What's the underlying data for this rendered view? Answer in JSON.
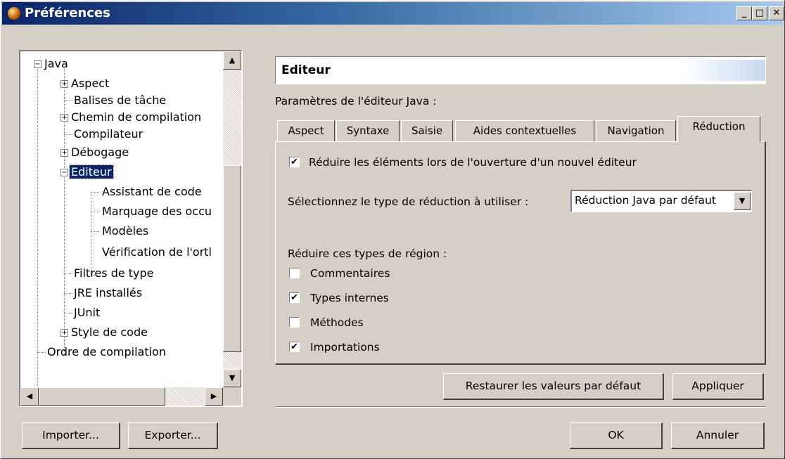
{
  "window": {
    "title": "Préférences"
  },
  "tree": {
    "items": [
      {
        "label": "Java",
        "expander": "minus"
      },
      {
        "label": "Aspect",
        "expander": "plus"
      },
      {
        "label": "Balises de tâche",
        "expander": ""
      },
      {
        "label": "Chemin de compilation",
        "expander": "plus"
      },
      {
        "label": "Compilateur",
        "expander": ""
      },
      {
        "label": "Débogage",
        "expander": "plus"
      },
      {
        "label": "Editeur",
        "expander": "minus",
        "selected": true
      },
      {
        "label": "Assistant de code",
        "expander": ""
      },
      {
        "label": "Marquage des occu",
        "expander": ""
      },
      {
        "label": "Modèles",
        "expander": ""
      },
      {
        "label": "Vérification de l'ortl",
        "expander": ""
      },
      {
        "label": "Filtres de type",
        "expander": ""
      },
      {
        "label": "JRE installés",
        "expander": ""
      },
      {
        "label": "JUnit",
        "expander": ""
      },
      {
        "label": "Style de code",
        "expander": "plus"
      },
      {
        "label": "Ordre de compilation",
        "expander": ""
      }
    ],
    "scroll_icons": {
      "up": "▲",
      "down": "▼",
      "left": "◀",
      "right": "▶"
    }
  },
  "page": {
    "header": "Editeur",
    "description": "Paramètres de l'éditeur Java :",
    "tabs": [
      {
        "label": "Aspect"
      },
      {
        "label": "Syntaxe"
      },
      {
        "label": "Saisie"
      },
      {
        "label": "Aides contextuelles"
      },
      {
        "label": "Navigation"
      },
      {
        "label": "Réduction",
        "active": true
      }
    ],
    "reduction": {
      "enable_label": "Réduire les éléments lors de l'ouverture d'un nouvel éditeur",
      "enable_checked": true,
      "type_label": "Sélectionnez le type de réduction à utiliser :",
      "type_value": "Réduction Java par défaut",
      "region_label": "Réduire ces types de région :",
      "regions": [
        {
          "label": "Commentaires",
          "checked": false
        },
        {
          "label": "Types internes",
          "checked": true
        },
        {
          "label": "Méthodes",
          "checked": false
        },
        {
          "label": "Importations",
          "checked": true
        }
      ]
    },
    "restore_button": "Restaurer les valeurs par défaut",
    "apply_button": "Appliquer"
  },
  "footer": {
    "import_button": "Importer...",
    "export_button": "Exporter...",
    "ok_button": "OK",
    "cancel_button": "Annuler"
  },
  "glyphs": {
    "check": "✔",
    "minus": "−",
    "plus": "+",
    "dropdown": "▼",
    "minimize": "_",
    "maximize": "□",
    "close": "✕"
  }
}
